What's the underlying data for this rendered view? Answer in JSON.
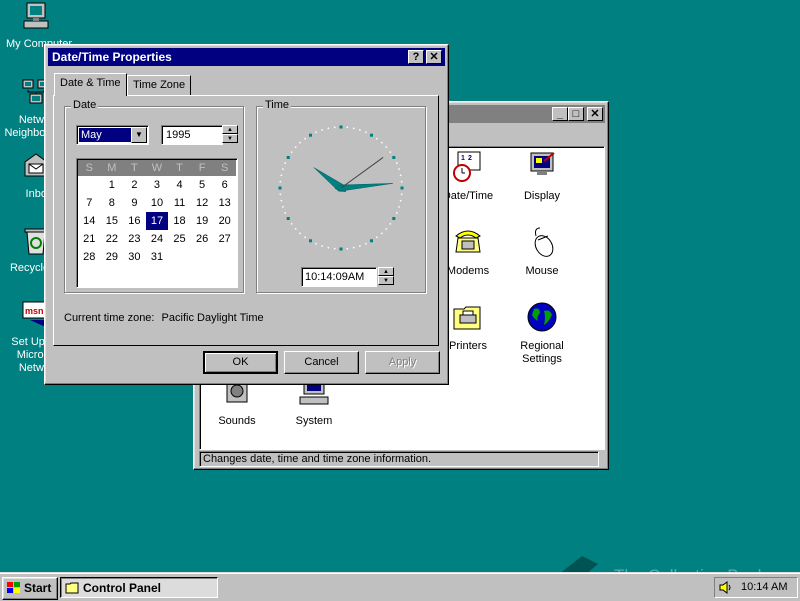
{
  "desktop": {
    "icons": [
      {
        "label": "My Computer",
        "icon": "computer-icon"
      },
      {
        "label": "Network Neighborhood",
        "icon": "network-icon"
      },
      {
        "label": "Inbox",
        "icon": "inbox-icon"
      },
      {
        "label": "Recycle Bin",
        "icon": "recycle-bin-icon"
      },
      {
        "label": "Set Up The Microsoft Network",
        "icon": "msn-icon"
      }
    ]
  },
  "control_panel": {
    "title": "",
    "items": [
      {
        "label": "Date/Time",
        "icon": "calendar-clock-icon"
      },
      {
        "label": "Display",
        "icon": "display-icon"
      },
      {
        "label": "Modems",
        "icon": "telephone-icon"
      },
      {
        "label": "Mouse",
        "icon": "mouse-icon"
      },
      {
        "label": "Printers",
        "icon": "printer-folder-icon"
      },
      {
        "label": "Regional Settings",
        "icon": "globe-icon"
      },
      {
        "label": "Sounds",
        "icon": "speaker-icon"
      },
      {
        "label": "System",
        "icon": "computer-icon"
      }
    ],
    "status": "Changes date, time and time zone information."
  },
  "datetime": {
    "title": "Date/Time Properties",
    "tabs": [
      "Date & Time",
      "Time Zone"
    ],
    "date_group": "Date",
    "time_group": "Time",
    "month": "May",
    "year": "1995",
    "weekdays": [
      "S",
      "M",
      "T",
      "W",
      "T",
      "F",
      "S"
    ],
    "weeks": [
      [
        "",
        "1",
        "2",
        "3",
        "4",
        "5",
        "6"
      ],
      [
        "7",
        "8",
        "9",
        "10",
        "11",
        "12",
        "13"
      ],
      [
        "14",
        "15",
        "16",
        "17",
        "18",
        "19",
        "20"
      ],
      [
        "21",
        "22",
        "23",
        "24",
        "25",
        "26",
        "27"
      ],
      [
        "28",
        "29",
        "30",
        "31",
        "",
        "",
        ""
      ]
    ],
    "selected_day": "17",
    "time": "10:14:09AM",
    "clock": {
      "hour": 10,
      "minute": 14,
      "second": 9
    },
    "timezone_label": "Current time zone:",
    "timezone": "Pacific Daylight Time",
    "ok": "OK",
    "cancel": "Cancel",
    "apply": "Apply"
  },
  "taskbar": {
    "start": "Start",
    "task": "Control Panel",
    "clock": "10:14 AM"
  },
  "watermark": "The Collection Book"
}
